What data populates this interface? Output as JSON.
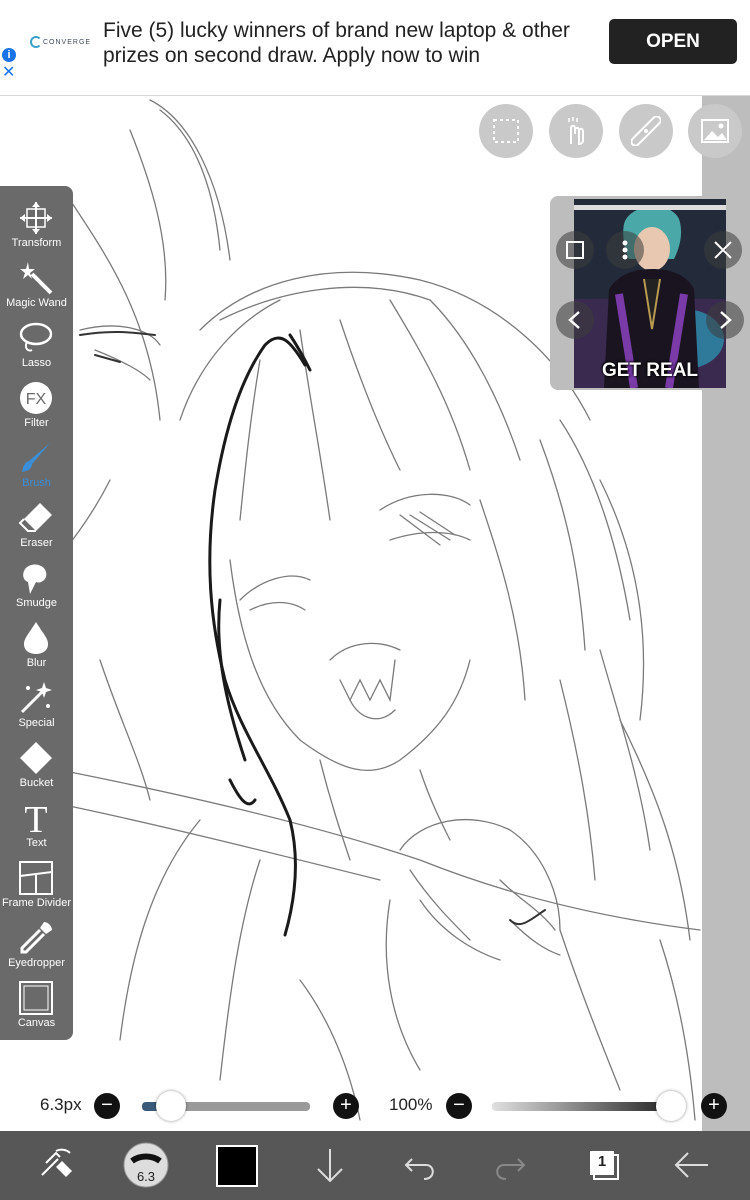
{
  "ad": {
    "brand": "CONVERGE",
    "text": "Five (5) lucky winners of brand new laptop & other prizes on second draw. Apply now to win",
    "open_label": "OPEN",
    "info_icon": "info-icon",
    "close_icon": "close-icon"
  },
  "top_buttons": [
    {
      "name": "selection-icon"
    },
    {
      "name": "hand-gesture-icon"
    },
    {
      "name": "ruler-icon"
    },
    {
      "name": "image-icon"
    }
  ],
  "tools": [
    {
      "label": "Transform",
      "icon": "transform-icon"
    },
    {
      "label": "Magic Wand",
      "icon": "magic-wand-icon"
    },
    {
      "label": "Lasso",
      "icon": "lasso-icon"
    },
    {
      "label": "Filter",
      "icon": "fx-icon"
    },
    {
      "label": "Brush",
      "icon": "brush-icon",
      "active": true
    },
    {
      "label": "Eraser",
      "icon": "eraser-icon"
    },
    {
      "label": "Smudge",
      "icon": "smudge-icon"
    },
    {
      "label": "Blur",
      "icon": "blur-icon"
    },
    {
      "label": "Special",
      "icon": "special-icon"
    },
    {
      "label": "Bucket",
      "icon": "bucket-icon"
    },
    {
      "label": "Text",
      "icon": "text-icon"
    },
    {
      "label": "Frame Divider",
      "icon": "frame-divider-icon"
    },
    {
      "label": "Eyedropper",
      "icon": "eyedropper-icon"
    },
    {
      "label": "Canvas",
      "icon": "canvas-icon"
    }
  ],
  "reference": {
    "caption": "GET REAL"
  },
  "brush_size": {
    "label": "6.3px",
    "value_fraction": 0.05
  },
  "opacity": {
    "label": "100%",
    "value_fraction": 1.0
  },
  "bottom": {
    "brush_badge": "6.3",
    "layer_count": "1",
    "color": "#000000"
  },
  "colors": {
    "accent": "#3a8fd8",
    "toolbar": "#6a6a6a",
    "bottombar": "#575757"
  }
}
